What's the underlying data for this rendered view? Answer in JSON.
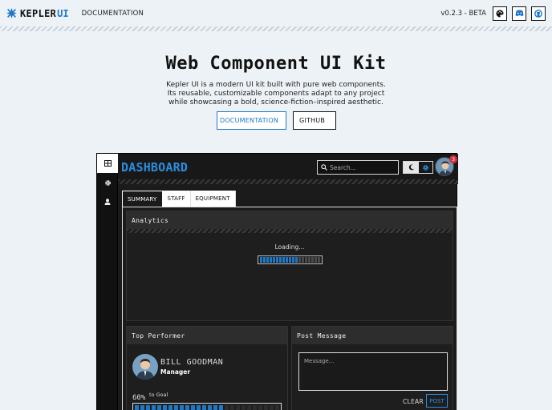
{
  "topnav": {
    "brand_main": "KEPLER",
    "brand_accent": "UI",
    "documentation_link": "DOCUMENTATION",
    "version": "v0.2.3 - BETA",
    "icons": [
      "palette-icon",
      "discord-icon",
      "github-icon"
    ]
  },
  "hero": {
    "title": "Web Component UI Kit",
    "description": "Kepler UI is a modern UI kit built with pure web components. Its reusable, customizable components adapt to any project while showcasing a bold, science-fiction–inspired aesthetic.",
    "documentation_button": "DOCUMENTATION",
    "github_button": "GITHUB"
  },
  "dashboard": {
    "title": "DASHBOARD",
    "search_placeholder": "Search...",
    "notification_count": "3",
    "sidebar_icons": [
      "dashboard-icon",
      "gear-icon",
      "user-icon"
    ],
    "tabs": [
      "SUMMARY",
      "STAFF",
      "EQUIPMENT"
    ],
    "active_tab": "SUMMARY",
    "analytics": {
      "title": "Analytics",
      "loading_text": "Loading...",
      "loading_progress": 0.65
    },
    "top_performer": {
      "title": "Top Performer",
      "name": "BILL GOODMAN",
      "role": "Manager",
      "goal_percent": "60%",
      "goal_label": "to Goal",
      "goal_progress": 0.6
    },
    "post_message": {
      "title": "Post Message",
      "placeholder": "Message...",
      "clear_label": "CLEAR",
      "post_label": "POST"
    }
  },
  "colors": {
    "accent": "#1e78c8",
    "page_bg": "#edf2f6",
    "dash_bg": "#1b1b1b",
    "badge": "#d6303a"
  }
}
